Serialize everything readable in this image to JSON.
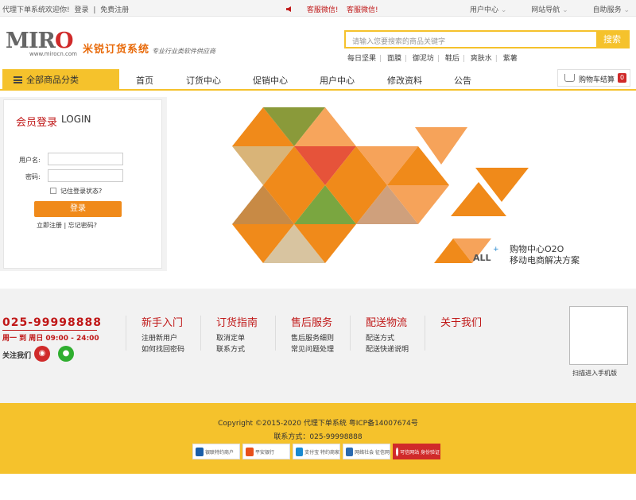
{
  "topbar": {
    "welcome": "代理下单系统欢迎你!",
    "login": "登录",
    "sep": "|",
    "register": "免费注册",
    "service1": "客服微信!",
    "service2": "客服微信!",
    "right_links": [
      "用户中心",
      "网站导航",
      "自助服务"
    ]
  },
  "header": {
    "logo_text": "MIRO",
    "logo_url": "www.mirocn.com",
    "brand_cn": "米锐订货系统",
    "brand_sub": "专业行业类软件供应商",
    "search_placeholder": "请输入您要搜索的商品关键字",
    "search_button": "搜索",
    "hot_words": [
      "每日坚果",
      "面膜",
      "御泥坊",
      "鞋后",
      "爽肤水",
      "紫薯"
    ]
  },
  "nav": {
    "all_categories": "全部商品分类",
    "items": [
      "首页",
      "订货中心",
      "促销中心",
      "用户中心",
      "修改资料",
      "公告"
    ],
    "cart_label": "购物车结算",
    "cart_count": "0"
  },
  "login": {
    "title_cn": "会员登录",
    "title_en": "LOGIN",
    "username_label": "用户名:",
    "password_label": "密码:",
    "remember": "记住登录状态?",
    "submit": "登录",
    "register_link": "立即注册",
    "link_sep": "|",
    "forgot_link": "忘记密码?"
  },
  "banner": {
    "logo_text": "ALL",
    "line1": "购物中心O2O",
    "line2": "移动电商解决方案"
  },
  "footer": {
    "phone": "025-99998888",
    "hours": "周一 到 周日  09:00 - 24:00",
    "follow": "关注我们",
    "columns": [
      {
        "title": "新手入门",
        "links": [
          "注册新用户",
          "如何找回密码"
        ]
      },
      {
        "title": "订货指南",
        "links": [
          "取消定单",
          "联系方式"
        ]
      },
      {
        "title": "售后服务",
        "links": [
          "售后服务细则",
          "常见问题处理"
        ]
      },
      {
        "title": "配送物流",
        "links": [
          "配送方式",
          "配送快递说明"
        ]
      },
      {
        "title": "关于我们",
        "links": []
      }
    ],
    "qr_label": "扫描进入手机版",
    "copyright": "Copyright ©2015-2020 代理下单系统 粤ICP备14007674号",
    "contact": "联系方式：025-99998888",
    "badges": [
      "银联特约商户",
      "平安银行",
      "支付宝 特约商家",
      "网络社会 征信网",
      "可信网站 身份验证"
    ]
  },
  "colors": {
    "accent": "#f5c22c",
    "brand_red": "#c01818",
    "orange": "#f08a1a"
  }
}
